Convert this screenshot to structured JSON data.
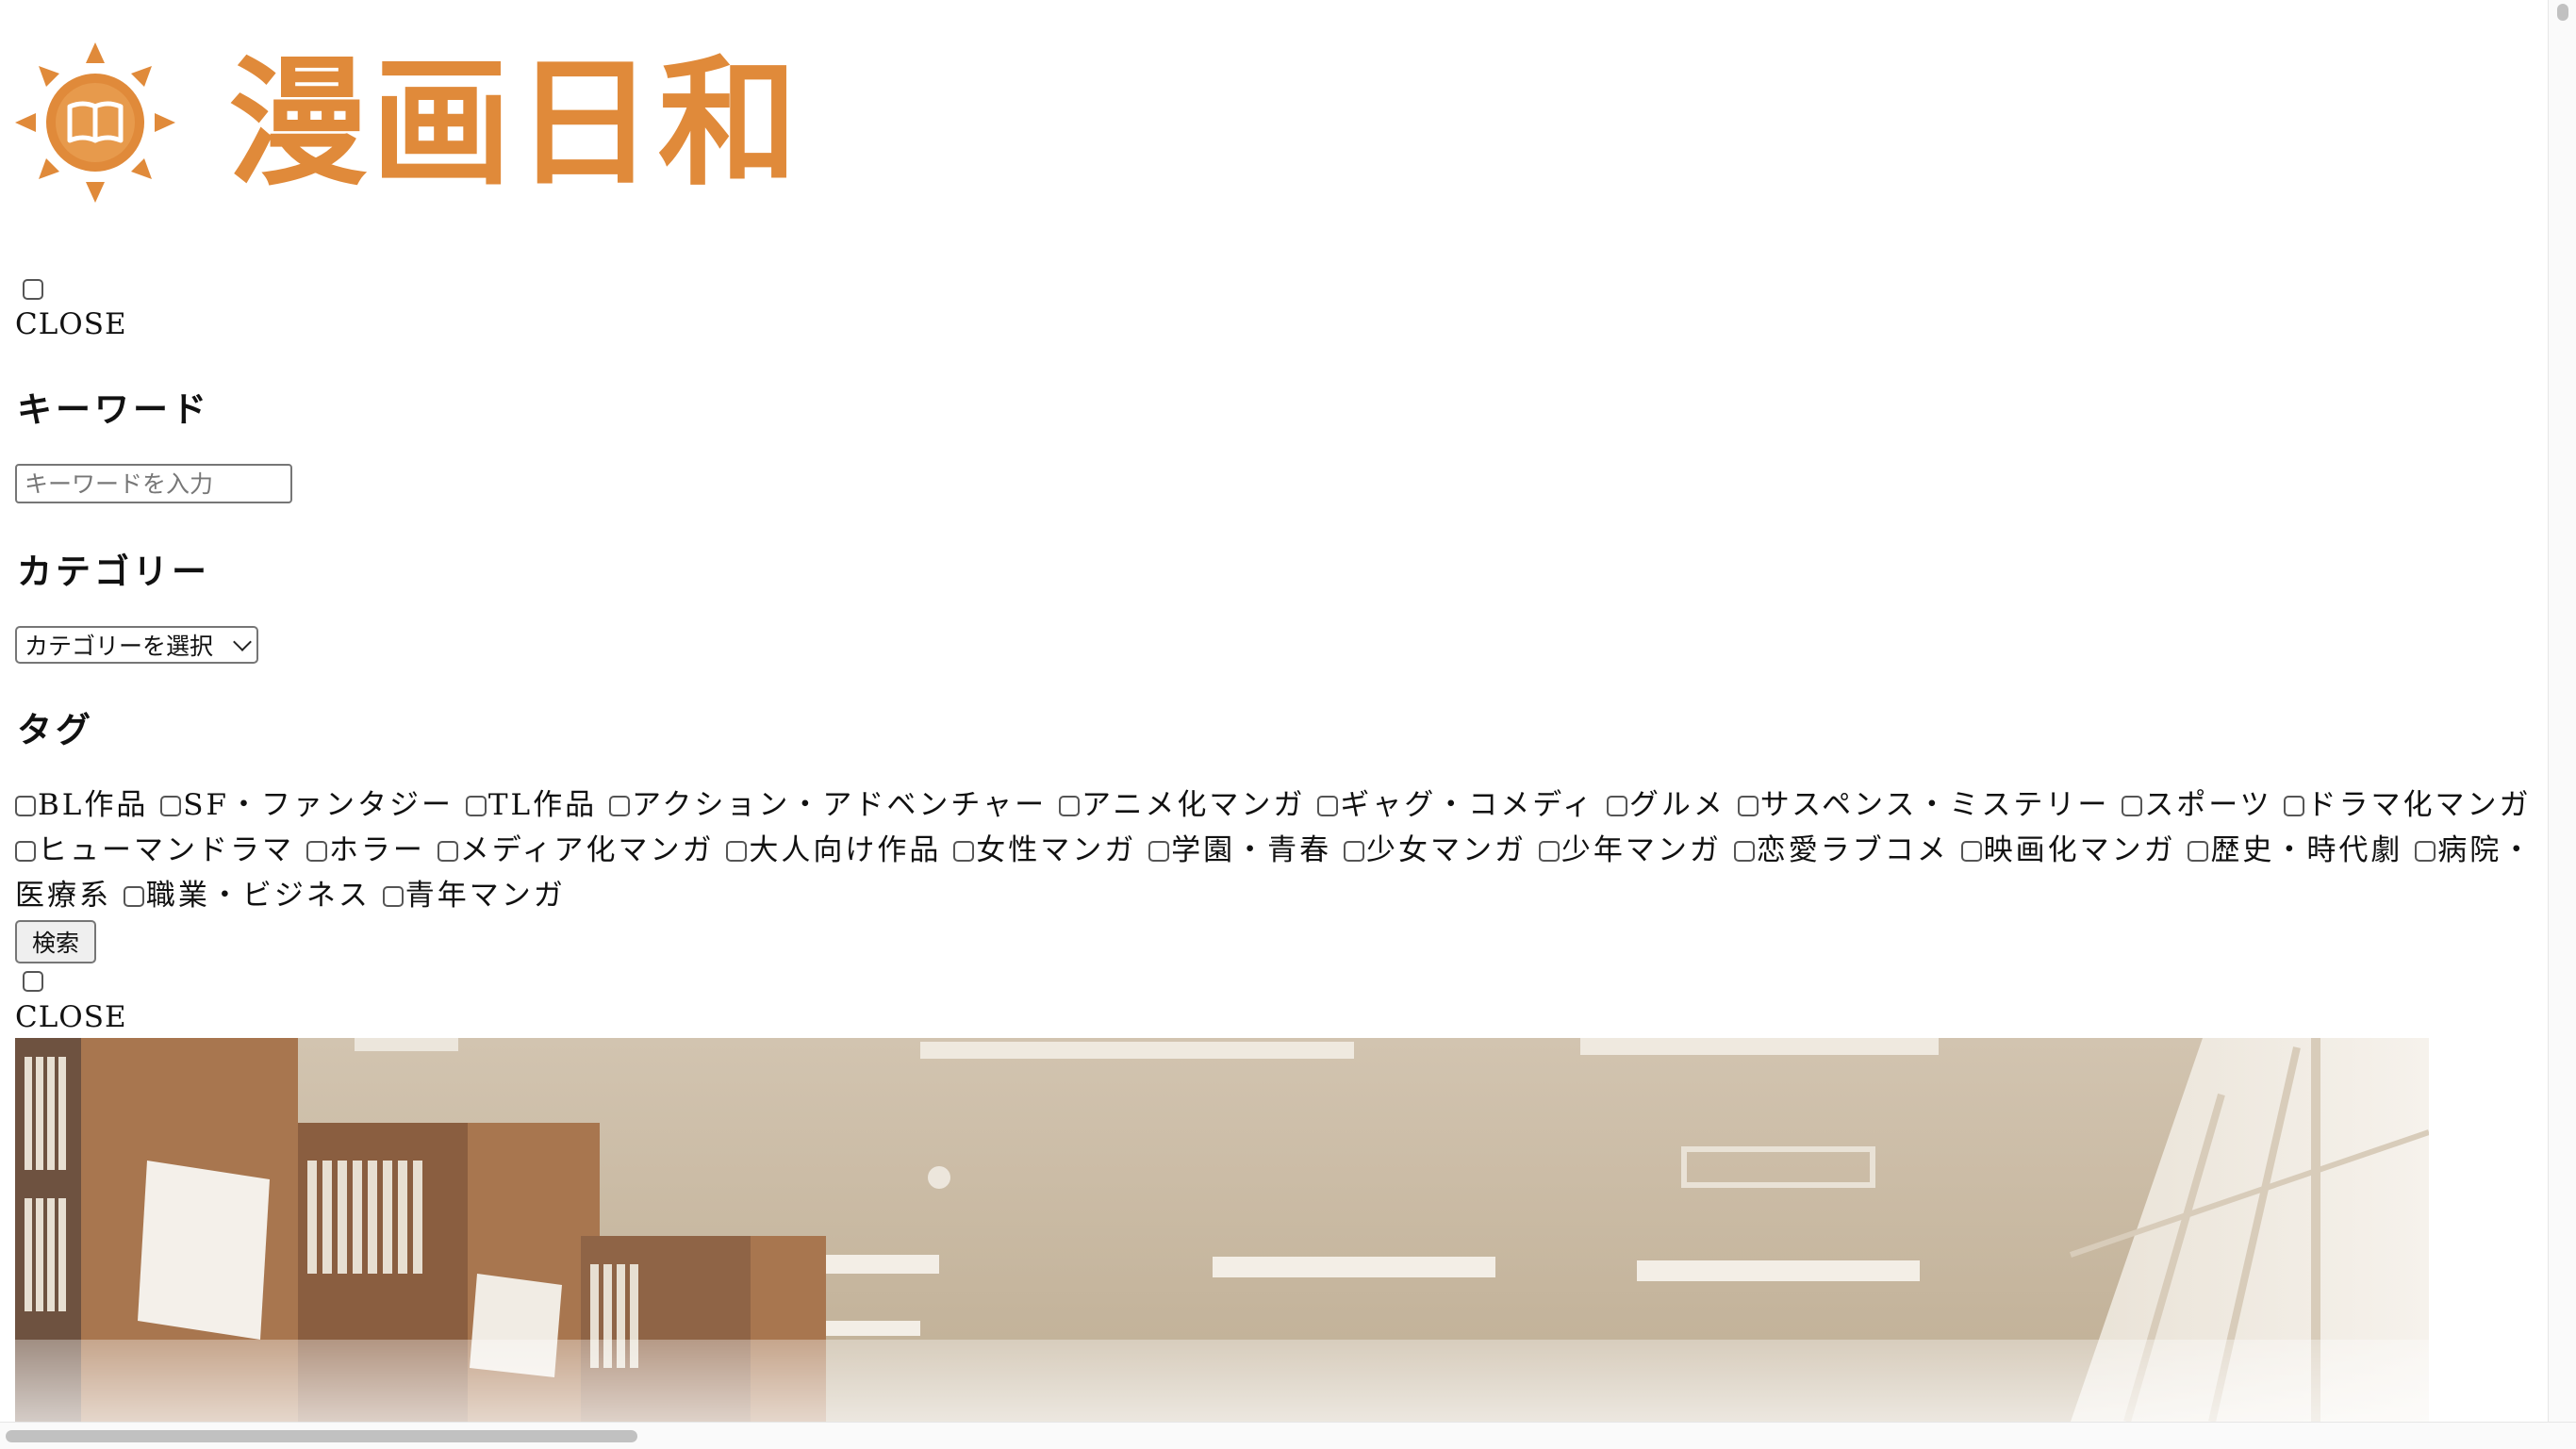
{
  "logo": {
    "title": "漫画日和",
    "color": "#e08a3a"
  },
  "menu_toggle_1": {
    "close_label": "CLOSE"
  },
  "search": {
    "keyword_heading": "キーワード",
    "keyword_placeholder": "キーワードを入力",
    "category_heading": "カテゴリー",
    "category_selected": "カテゴリーを選択",
    "tag_heading": "タグ",
    "tags": [
      "BL作品",
      "SF・ファンタジー",
      "TL作品",
      "アクション・アドベンチャー",
      "アニメ化マンガ",
      "ギャグ・コメディ",
      "グルメ",
      "サスペンス・ミステリー",
      "スポーツ",
      "ドラマ化マンガ",
      "ヒューマンドラマ",
      "ホラー",
      "メディア化マンガ",
      "大人向け作品",
      "女性マンガ",
      "学園・青春",
      "少女マンガ",
      "少年マンガ",
      "恋愛ラブコメ",
      "映画化マンガ",
      "歴史・時代劇",
      "病院・医療系",
      "職業・ビジネス",
      "青年マンガ"
    ],
    "submit_label": "検索"
  },
  "menu_toggle_2": {
    "close_label": "CLOSE"
  },
  "hero": {
    "icon": "library-interior-image"
  }
}
